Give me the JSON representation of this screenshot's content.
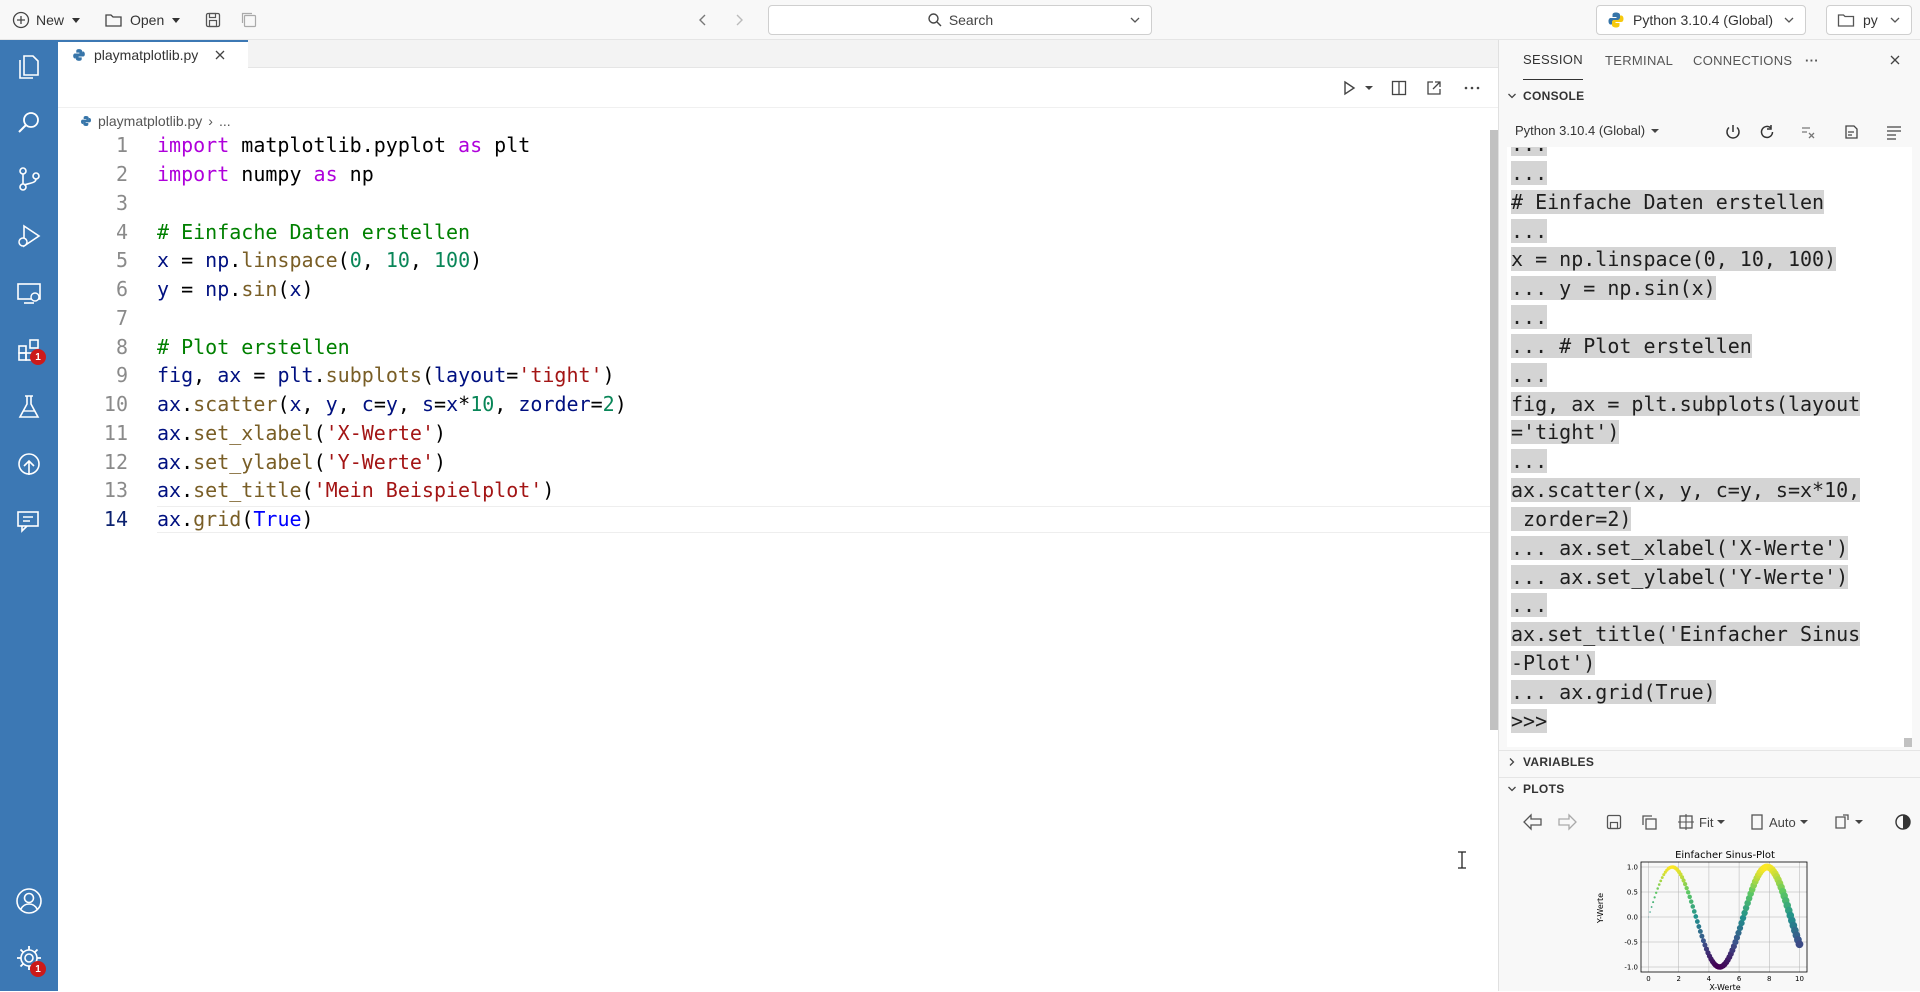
{
  "titlebar": {
    "new_label": "New",
    "open_label": "Open",
    "search_placeholder": "Search",
    "interpreter_label": "Python 3.10.4 (Global)",
    "folder_label": "py"
  },
  "activity_bar": {
    "extensions_badge": "1",
    "settings_badge": "1"
  },
  "editor": {
    "tab_label": "playmatplotlib.py",
    "breadcrumb_file": "playmatplotlib.py",
    "breadcrumb_more": "...",
    "line_numbers": [
      "1",
      "2",
      "3",
      "4",
      "5",
      "6",
      "7",
      "8",
      "9",
      "10",
      "11",
      "12",
      "13",
      "14"
    ]
  },
  "panel": {
    "tab_session": "SESSION",
    "tab_terminal": "TERMINAL",
    "tab_connections": "CONNECTIONS",
    "more_label": "···",
    "console_header": "CONSOLE",
    "console_interpreter": "Python 3.10.4 (Global)",
    "console_lines": [
      "...",
      "...",
      "# Einfache Daten erstellen",
      "...",
      "x = np.linspace(0, 10, 100)",
      "... y = np.sin(x)",
      "...",
      "... # Plot erstellen",
      "...",
      "fig, ax = plt.subplots(layout",
      "='tight')",
      "...",
      "ax.scatter(x, y, c=y, s=x*10,",
      " zorder=2)",
      "... ax.set_xlabel('X-Werte')",
      "... ax.set_ylabel('Y-Werte')",
      "...",
      "ax.set_title('Einfacher Sinus",
      "-Plot')",
      "... ax.grid(True)",
      ">>>"
    ],
    "variables_header": "VARIABLES",
    "plots_header": "PLOTS",
    "fit_label": "Fit",
    "auto_label": "Auto"
  },
  "chart_data": {
    "type": "scatter",
    "title": "Einfacher Sinus-Plot",
    "xlabel": "X-Werte",
    "ylabel": "Y-Werte",
    "xlim": [
      -0.5,
      10.5
    ],
    "ylim": [
      -1.1,
      1.1
    ],
    "xticks": [
      "0",
      "2",
      "4",
      "6",
      "8",
      "10"
    ],
    "yticks": [
      "1.0",
      "0.5",
      "0.0",
      "-0.5",
      "-1.0"
    ],
    "grid": true,
    "series": [
      {
        "function": "sin",
        "x_start": 0,
        "x_end": 10,
        "n_points": 100,
        "colormap": "viridis",
        "size_scale": "x*10"
      }
    ]
  }
}
